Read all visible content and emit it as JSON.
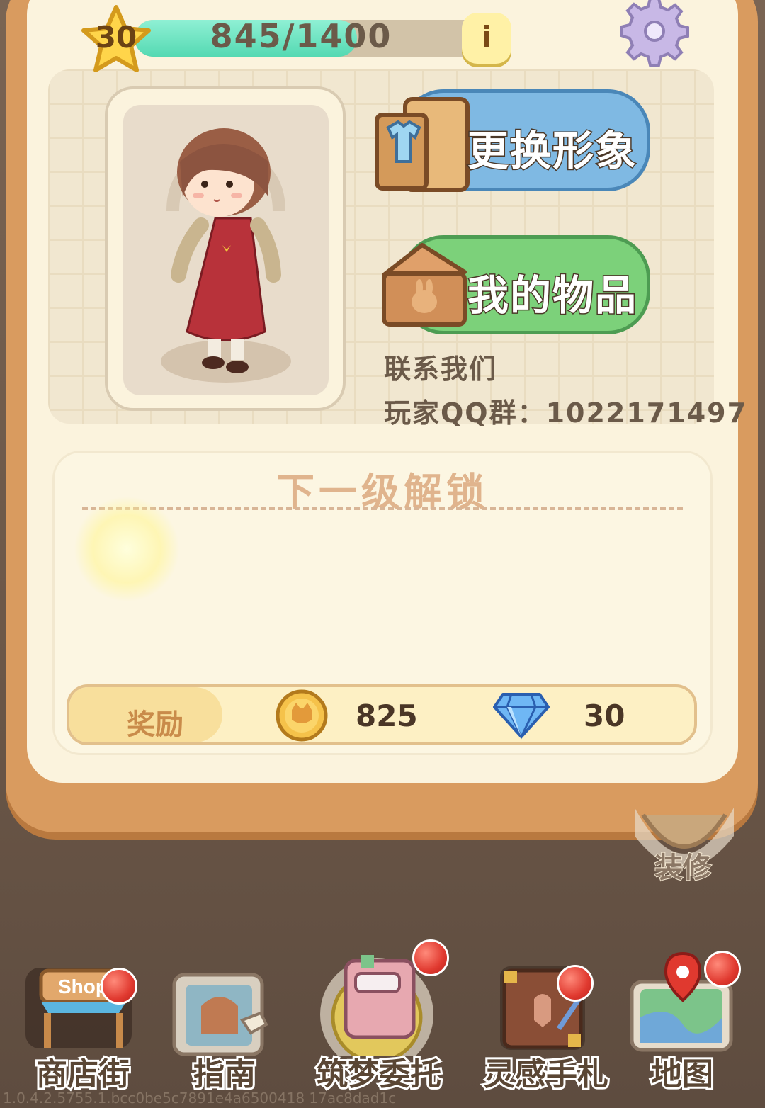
{
  "top_bar": {
    "level": "30",
    "xp_text": "845/1400",
    "xp_progress": 0.6036,
    "info_label": "i"
  },
  "profile": {
    "change_look_label": "更换形象",
    "my_items_label": "我的物品",
    "contact_title": "联系我们",
    "qq_group": "玩家QQ群：1022171497"
  },
  "next_level": {
    "title": "下一级解锁",
    "reward_label": "奖励",
    "coins": "825",
    "diamonds": "30"
  },
  "decorate_label": "装修",
  "nav": [
    {
      "label": "商店街",
      "sign": "Shop"
    },
    {
      "label": "指南"
    },
    {
      "label": "筑梦委托"
    },
    {
      "label": "灵感手札"
    },
    {
      "label": "地图"
    }
  ],
  "version": "1.0.4.2.5755.1.bcc0be5c7891e4a6500418 17ac8dad1c"
}
